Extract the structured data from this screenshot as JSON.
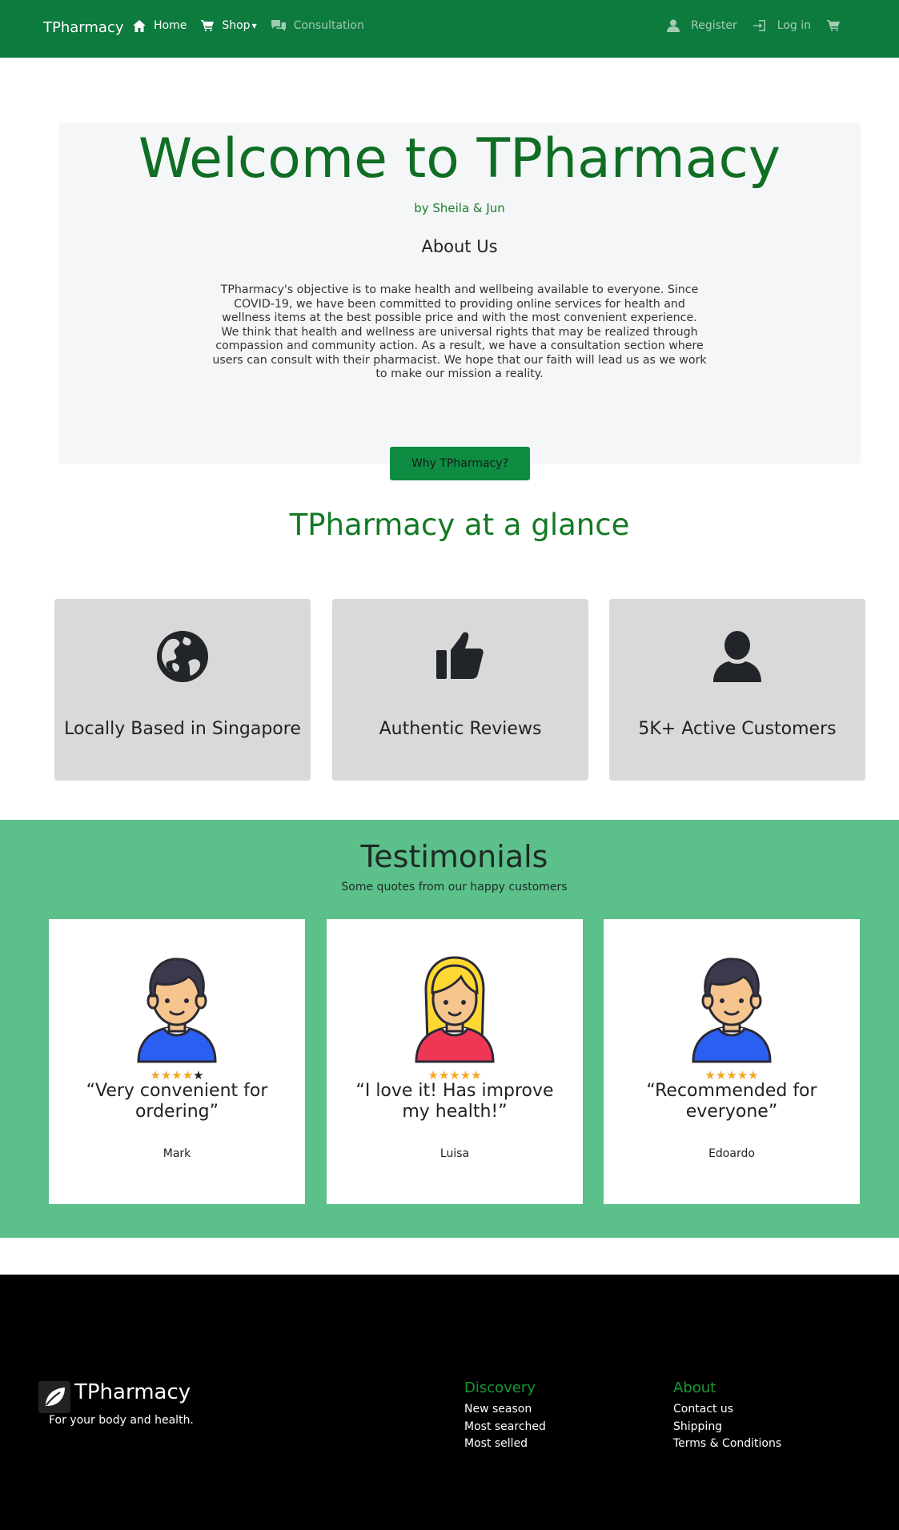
{
  "nav": {
    "brand": "TPharmacy",
    "home": "Home",
    "shop": "Shop",
    "consultation": "Consultation",
    "register": "Register",
    "login": "Log in",
    "icons": [
      "home-icon",
      "cart-icon",
      "chat-icon",
      "user-icon",
      "login-icon",
      "cart-icon"
    ]
  },
  "hero": {
    "title": "Welcome to TPharmacy",
    "byline": "by Sheila & Jun",
    "about_heading": "About Us",
    "about_text": "TPharmacy's objective is to make health and wellbeing available to everyone. Since COVID-19, we have been committed to providing online services for health and wellness items at the best possible price and with the most convenient experience. We think that health and wellness are universal rights that may be realized through compassion and community action. As a result, we have a consultation section where users can consult with their pharmacist. We hope that our faith will lead us as we work to make our mission a reality.",
    "button": "Why TPharmacy?"
  },
  "glance": {
    "title": "TPharmacy at a glance",
    "cards": [
      {
        "label": "Locally Based in Singapore",
        "icon": "globe-icon"
      },
      {
        "label": "Authentic Reviews",
        "icon": "thumbs-up-icon"
      },
      {
        "label": "5K+ Active Customers",
        "icon": "person-icon"
      }
    ]
  },
  "testimonials": {
    "title": "Testimonials",
    "subtitle": "Some quotes from our happy customers",
    "items": [
      {
        "quote": "“Very convenient for ordering”",
        "name": "Mark",
        "rating": 4
      },
      {
        "quote": "“I love it! Has improve my health!”",
        "name": "Luisa",
        "rating": 5
      },
      {
        "quote": "“Recommended for everyone”",
        "name": "Edoardo",
        "rating": 5
      }
    ]
  },
  "footer": {
    "brand": "TPharmacy",
    "tagline": "For your body and health.",
    "discovery": {
      "heading": "Discovery",
      "links": [
        "New season",
        "Most searched",
        "Most selled"
      ]
    },
    "about": {
      "heading": "About",
      "links": [
        "Contact us",
        "Shipping",
        "Terms & Conditions"
      ]
    }
  },
  "colors": {
    "nav_bg": "#0d7a3e",
    "accent_green": "#0f6e23",
    "testimonial_bg": "#5bc08a",
    "star": "#f5a623",
    "footer_bg": "#000000"
  }
}
